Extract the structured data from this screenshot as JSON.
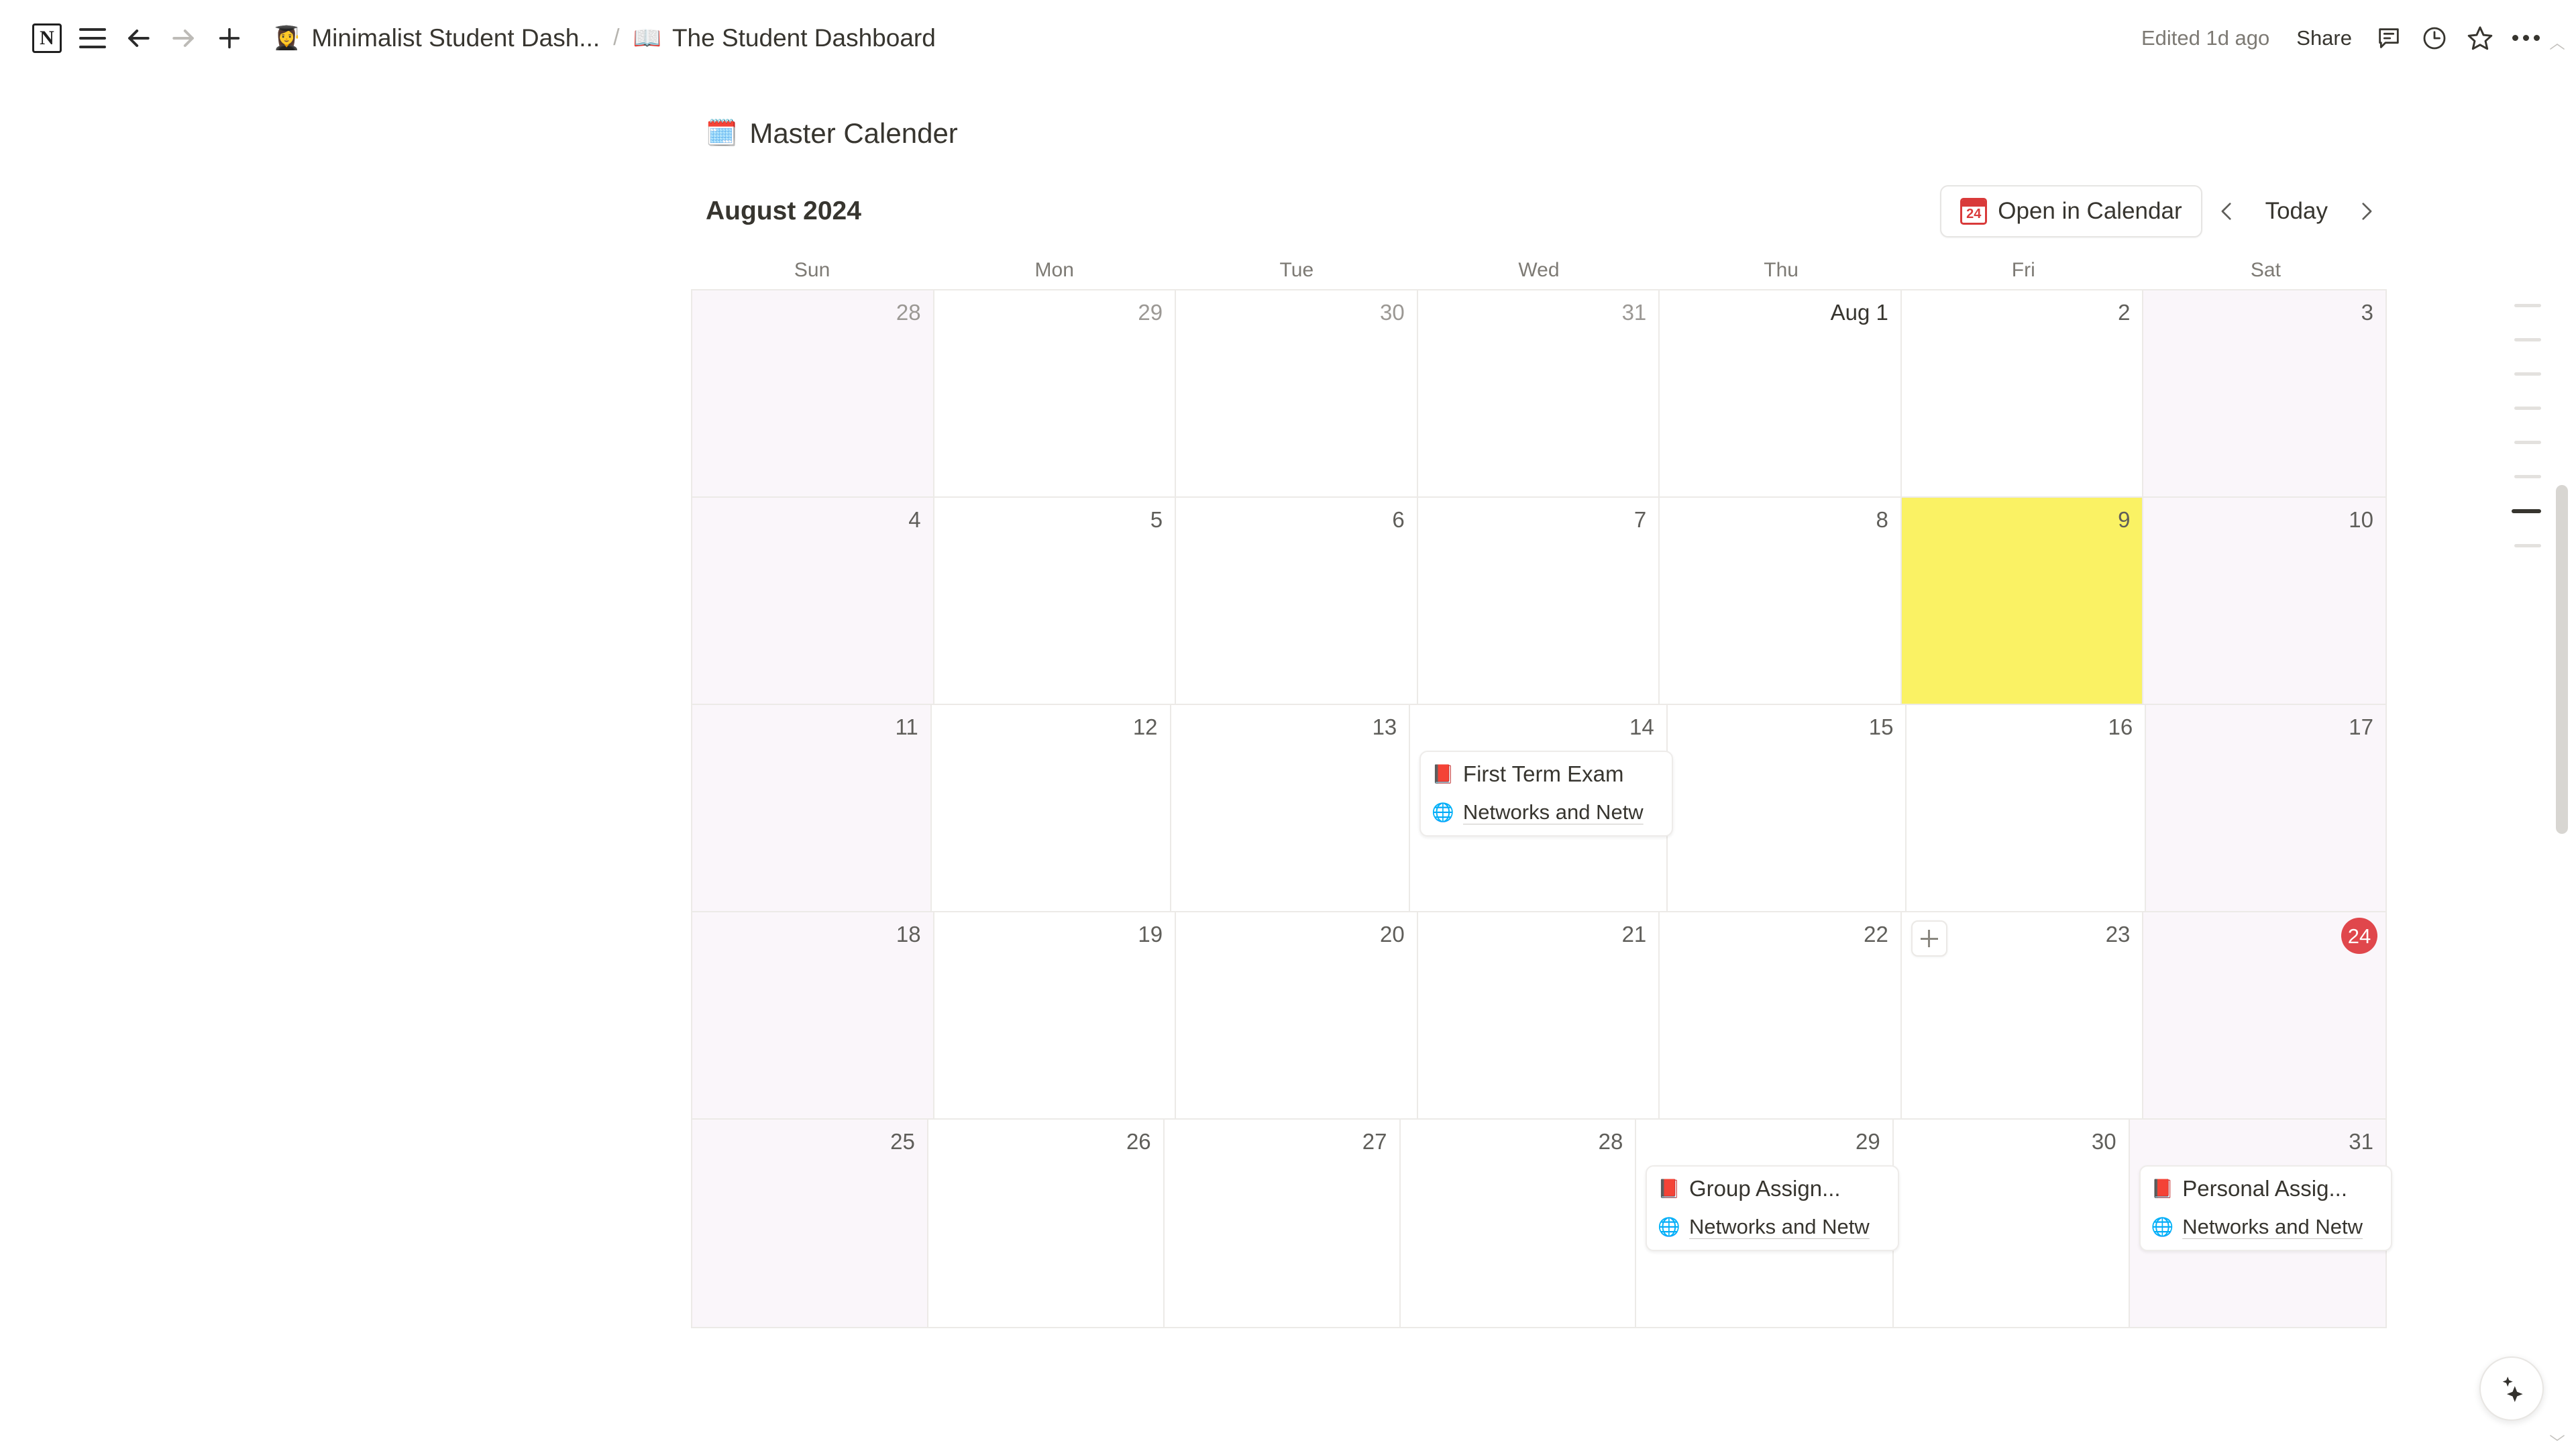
{
  "topbar": {
    "logo_label": "N",
    "icons": {
      "menu": "hamburger-menu-icon",
      "back": "back-arrow-icon",
      "forward": "forward-arrow-icon",
      "new": "plus-icon"
    },
    "breadcrumb": [
      {
        "emoji": "👩‍🎓",
        "label": "Minimalist Student Dash..."
      },
      {
        "emoji": "📖",
        "label": "The Student Dashboard"
      }
    ],
    "separator": "/",
    "edited": "Edited 1d ago",
    "share_label": "Share",
    "right_icons": [
      "comment-icon",
      "history-clock-icon",
      "star-icon",
      "more-options-icon"
    ]
  },
  "block": {
    "emoji": "🗓️",
    "title": "Master Calender"
  },
  "calendar": {
    "month_label": "August 2024",
    "open_button_label": "Open in Calendar",
    "open_button_badge": "24",
    "today_label": "Today",
    "prev_label": "‹",
    "next_label": "›",
    "weekdays": [
      "Sun",
      "Mon",
      "Tue",
      "Wed",
      "Thu",
      "Fri",
      "Sat"
    ],
    "weeks": [
      [
        {
          "num": "28",
          "outside": true,
          "weekend": true
        },
        {
          "num": "29",
          "outside": true
        },
        {
          "num": "30",
          "outside": true
        },
        {
          "num": "31",
          "outside": true
        },
        {
          "num": "Aug 1",
          "month_start": true
        },
        {
          "num": "2"
        },
        {
          "num": "3",
          "weekend": true
        }
      ],
      [
        {
          "num": "4",
          "weekend": true
        },
        {
          "num": "5"
        },
        {
          "num": "6"
        },
        {
          "num": "7"
        },
        {
          "num": "8"
        },
        {
          "num": "9",
          "highlight": true
        },
        {
          "num": "10",
          "weekend": true
        }
      ],
      [
        {
          "num": "11",
          "weekend": true
        },
        {
          "num": "12"
        },
        {
          "num": "13"
        },
        {
          "num": "14",
          "events": [
            {
              "icon": "📕",
              "title": "First Term Exam",
              "sub_icon": "🌐",
              "sub": "Networks and Netw"
            }
          ]
        },
        {
          "num": "15"
        },
        {
          "num": "16"
        },
        {
          "num": "17",
          "weekend": true
        }
      ],
      [
        {
          "num": "18",
          "weekend": true
        },
        {
          "num": "19"
        },
        {
          "num": "20"
        },
        {
          "num": "21"
        },
        {
          "num": "22"
        },
        {
          "num": "23",
          "add_button": true
        },
        {
          "num": "24",
          "weekend": true,
          "today_badge": true
        }
      ],
      [
        {
          "num": "25",
          "weekend": true
        },
        {
          "num": "26"
        },
        {
          "num": "27"
        },
        {
          "num": "28"
        },
        {
          "num": "29",
          "events": [
            {
              "icon": "📕",
              "title": "Group Assign...",
              "sub_icon": "🌐",
              "sub": "Networks and Netw"
            }
          ]
        },
        {
          "num": "30"
        },
        {
          "num": "31",
          "weekend": true,
          "events": [
            {
              "icon": "📕",
              "title": "Personal Assig...",
              "sub_icon": "🌐",
              "sub": "Networks and Netw"
            }
          ]
        }
      ]
    ]
  },
  "rail": {
    "toc_marks": [
      {
        "width": 40,
        "active": false
      },
      {
        "width": 40,
        "active": false
      },
      {
        "width": 40,
        "active": false
      },
      {
        "width": 40,
        "active": false
      },
      {
        "width": 40,
        "active": false
      },
      {
        "width": 40,
        "active": false
      },
      {
        "width": 44,
        "active": true
      },
      {
        "width": 40,
        "active": false
      }
    ]
  },
  "fab": {
    "name": "ai-assistant-button"
  },
  "colors": {
    "today_highlight": "#faf264",
    "today_badge": "#e0474c",
    "weekend_tint": "#faf6fa",
    "grid_line": "#eceae7",
    "text": "#37352f",
    "muted": "#7d7a74"
  }
}
